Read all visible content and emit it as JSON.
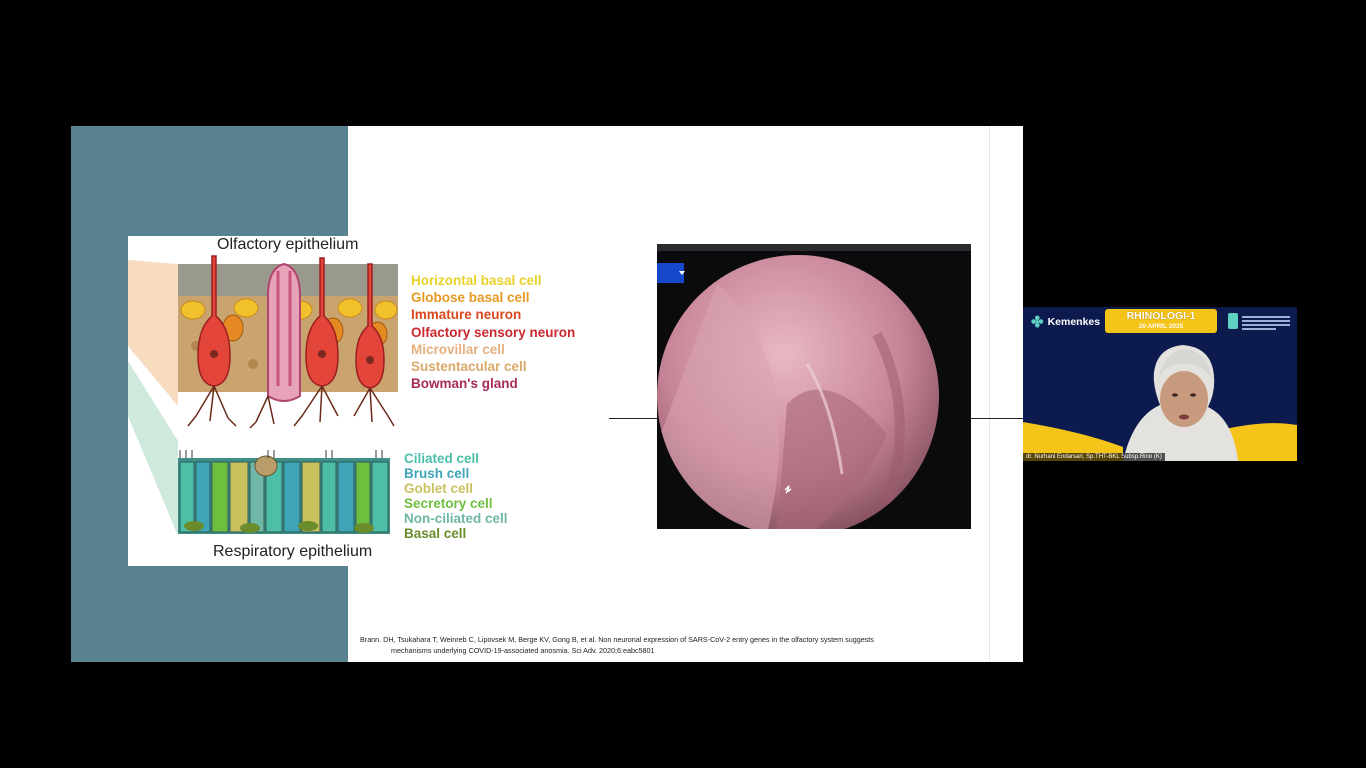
{
  "slide": {
    "colors": {
      "band": "#5a8391",
      "background": "#ffffff"
    },
    "figure": {
      "title_top": "Olfactory epithelium",
      "title_bottom": "Respiratory epithelium",
      "olfactory_cells": [
        {
          "label": "Horizontal basal cell",
          "color": "#e8d22a"
        },
        {
          "label": "Globose basal cell",
          "color": "#e69a24"
        },
        {
          "label": "Immature neuron",
          "color": "#d9481f"
        },
        {
          "label": "Olfactory sensory neuron",
          "color": "#c8282e"
        },
        {
          "label": "Microvillar cell",
          "color": "#e6b07e"
        },
        {
          "label": "Sustentacular cell",
          "color": "#d9a86a"
        },
        {
          "label": "Bowman's gland",
          "color": "#a72a5c"
        }
      ],
      "respiratory_cells": [
        {
          "label": "Ciliated cell",
          "color": "#4dbfa8"
        },
        {
          "label": "Brush cell",
          "color": "#3ea5b8"
        },
        {
          "label": "Goblet cell",
          "color": "#c9c15e"
        },
        {
          "label": "Secretory cell",
          "color": "#6fbf3f"
        },
        {
          "label": "Non-ciliated cell",
          "color": "#6fb7a7"
        },
        {
          "label": "Basal cell",
          "color": "#6b8c2b"
        }
      ]
    },
    "citation": {
      "line1": "Brann. DH, Tsukahara T, Weinreb C, Lipovsek M, Berge KV, Gong B, et al. Non neuronal expression of SARS-CoV-2 entry genes in the olfactory system suggests",
      "line2": "mechanisms underlying COVID-19-associated anosmia. Sci Adv. 2020;6:eabc5801"
    }
  },
  "webcam": {
    "logo_text": "Kemenkes",
    "event_title": "RHINOLOGI-1",
    "event_date": "20 APRIL 2025",
    "speaker_name": "dr. Nurhani Endarsari, Sp.THT-BKL Subsp.Rino (K)",
    "colors": {
      "background": "#0c1a4e",
      "accent": "#f5c419"
    }
  }
}
